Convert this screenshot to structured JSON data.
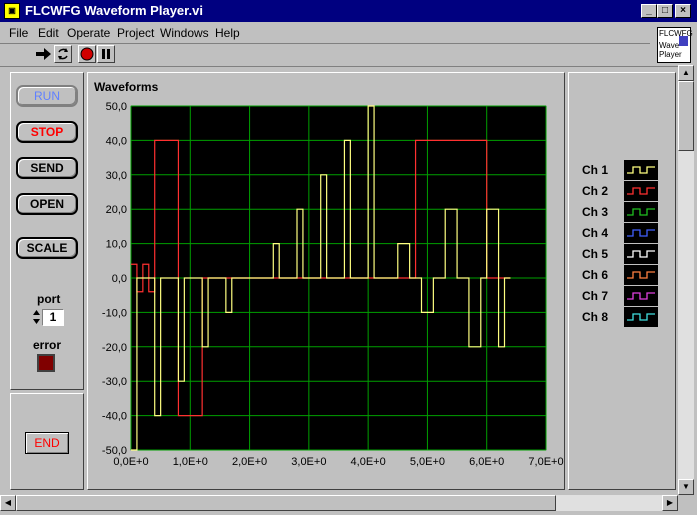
{
  "window": {
    "title": "FLCWFG Waveform Player.vi"
  },
  "menu": [
    "File",
    "Edit",
    "Operate",
    "Project",
    "Windows",
    "Help"
  ],
  "vi_icon": {
    "line1": "FLCWFG",
    "line2": "Wave",
    "line3": "Player"
  },
  "buttons": {
    "run": "RUN",
    "stop": "STOP",
    "send": "SEND",
    "open": "OPEN",
    "scale": "SCALE",
    "end": "END"
  },
  "port": {
    "label": "port",
    "value": "1"
  },
  "error": {
    "label": "error"
  },
  "legend": {
    "items": [
      {
        "name": "Ch 1",
        "color": "#ffff80"
      },
      {
        "name": "Ch 2",
        "color": "#ff3030"
      },
      {
        "name": "Ch 3",
        "color": "#20c020"
      },
      {
        "name": "Ch 4",
        "color": "#4060ff"
      },
      {
        "name": "Ch 5",
        "color": "#ffffff"
      },
      {
        "name": "Ch 6",
        "color": "#ff8040"
      },
      {
        "name": "Ch 7",
        "color": "#e040e0"
      },
      {
        "name": "Ch 8",
        "color": "#40e0e0"
      }
    ]
  },
  "colors": {
    "titlebar": "#000080",
    "plot_bg": "#000000",
    "grid": "#00a000",
    "run_text": "#6080ff",
    "stop_text": "#ff0000",
    "end_text": "#ff0000"
  },
  "chart_data": {
    "type": "line",
    "title": "Waveforms",
    "xlim": [
      0,
      7
    ],
    "ylim": [
      -50,
      50
    ],
    "x_tick_labels": [
      "0,0E+0",
      "1,0E+0",
      "2,0E+0",
      "3,0E+0",
      "4,0E+0",
      "5,0E+0",
      "6,0E+0",
      "7,0E+0"
    ],
    "y_tick_labels": [
      "50,0",
      "40,0",
      "30,0",
      "20,0",
      "10,0",
      "0,0",
      "-10,0",
      "-20,0",
      "-30,0",
      "-40,0",
      "-50,0"
    ],
    "grid": true,
    "series": [
      {
        "color": "#ffff80",
        "step": true,
        "x": [
          0.0,
          0.1,
          0.2,
          0.4,
          0.5,
          0.8,
          0.9,
          1.2,
          1.3,
          1.6,
          1.7,
          2.4,
          2.5,
          2.8,
          2.9,
          3.2,
          3.3,
          3.6,
          3.7,
          4.0,
          4.1,
          4.5,
          4.7,
          4.9,
          5.1,
          5.3,
          5.5,
          5.7,
          5.9,
          6.0,
          6.2,
          6.3,
          6.4
        ],
        "y": [
          -50,
          0,
          0,
          -40,
          0,
          -30,
          0,
          -20,
          0,
          -10,
          0,
          10,
          0,
          20,
          0,
          30,
          0,
          40,
          0,
          50,
          0,
          10,
          0,
          -10,
          0,
          20,
          0,
          -20,
          0,
          20,
          -20,
          0,
          0
        ]
      },
      {
        "color": "#ff3030",
        "step": true,
        "x": [
          0.0,
          0.1,
          0.2,
          0.3,
          0.4,
          0.8,
          1.2,
          1.3,
          1.6,
          1.7,
          4.7,
          4.8,
          6.0,
          6.1,
          6.4
        ],
        "y": [
          4,
          -4,
          4,
          -4,
          40,
          -40,
          0,
          0,
          0,
          0,
          0,
          40,
          0,
          0,
          0
        ]
      }
    ]
  }
}
